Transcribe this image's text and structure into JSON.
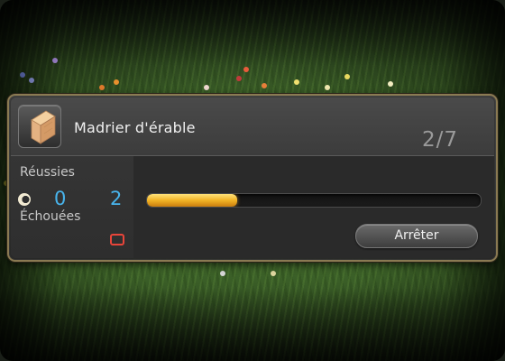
{
  "item": {
    "name": "Madrier d'érable",
    "icon": "maple-lumber-icon"
  },
  "step": {
    "display": "2/7",
    "current": 2,
    "total": 7
  },
  "results": {
    "success_label": "Réussies",
    "failed_label": "Échouées",
    "success_hq_count": "0",
    "success_nq_count": "2",
    "failed_count": ""
  },
  "progress": {
    "fraction": 0.27,
    "color": "#f2b325"
  },
  "stop_button": {
    "label": "Arrêter"
  },
  "colors": {
    "border": "#8a7a52",
    "count_blue": "#48b4ec",
    "failed_red": "#e8453a"
  }
}
